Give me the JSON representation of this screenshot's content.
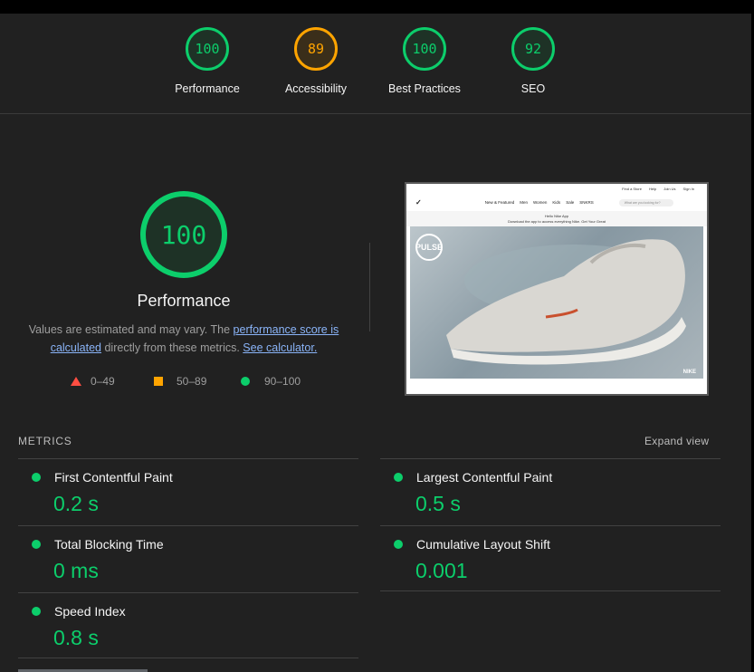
{
  "gauges": [
    {
      "score": "100",
      "label": "Performance"
    },
    {
      "score": "89",
      "label": "Accessibility"
    },
    {
      "score": "100",
      "label": "Best Practices"
    },
    {
      "score": "92",
      "label": "SEO"
    }
  ],
  "performance": {
    "score": "100",
    "title": "Performance",
    "desc_prefix": "Values are estimated and may vary. The ",
    "score_link": "performance score is calculated",
    "desc_middle": " directly from these metrics. ",
    "calc_link": "See calculator."
  },
  "legend": {
    "fail": "0–49",
    "average": "50–89",
    "pass": "90–100"
  },
  "colors": {
    "pass": "#0cce6b",
    "average": "#ffa400",
    "fail": "#ff4e42"
  },
  "screenshot": {
    "top_links": [
      "Find a Store",
      "Help",
      "Join Us",
      "Sign In"
    ],
    "logo": "✓",
    "menu": [
      "New & Featured",
      "Men",
      "Women",
      "Kids",
      "Sale",
      "SNKRS"
    ],
    "search_placeholder": "What are you looking for?",
    "promo_line1": "Hello Nike App",
    "promo_line2": "Download the app to access everything Nike. Get Your Great",
    "badge": "PULSE",
    "footer": "NIKE"
  },
  "metrics": {
    "title": "METRICS",
    "expand": "Expand view",
    "items": [
      {
        "name": "First Contentful Paint",
        "value": "0.2 s"
      },
      {
        "name": "Largest Contentful Paint",
        "value": "0.5 s"
      },
      {
        "name": "Total Blocking Time",
        "value": "0 ms"
      },
      {
        "name": "Cumulative Layout Shift",
        "value": "0.001"
      },
      {
        "name": "Speed Index",
        "value": "0.8 s"
      }
    ]
  }
}
